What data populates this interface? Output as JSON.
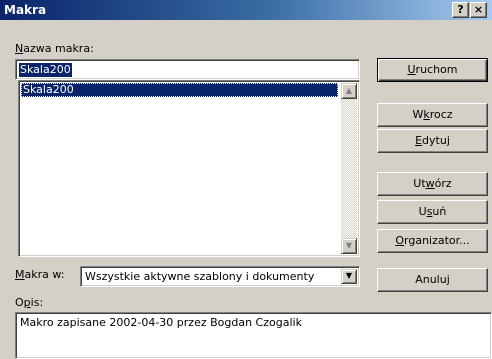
{
  "window": {
    "title": "Makra",
    "help_glyph": "?",
    "close_glyph": "×"
  },
  "name_field": {
    "label_pre": "",
    "label_mn": "N",
    "label_post": "azwa makra:",
    "value": "Skala200"
  },
  "macro_list": {
    "items": [
      "Skala200"
    ],
    "scroll_up_glyph": "▲",
    "scroll_down_glyph": "▼"
  },
  "macros_in": {
    "label_pre": "",
    "label_mn": "M",
    "label_post": "akra w:",
    "value": "Wszystkie aktywne szablony i dokumenty",
    "arrow_glyph": "▼"
  },
  "description": {
    "label_pre": "O",
    "label_mn": "p",
    "label_post": "is:",
    "text": "Makro zapisane 2002-04-30 przez Bogdan Czogalik"
  },
  "buttons": {
    "run": {
      "pre": "",
      "mn": "U",
      "post": "ruchom"
    },
    "step_into": {
      "pre": "W",
      "mn": "k",
      "post": "rocz"
    },
    "edit": {
      "pre": "",
      "mn": "E",
      "post": "dytuj"
    },
    "create": {
      "pre": "Ut",
      "mn": "w",
      "post": "órz"
    },
    "delete": {
      "pre": "U",
      "mn": "s",
      "post": "uń"
    },
    "organizer": {
      "pre": "",
      "mn": "O",
      "post": "rganizator..."
    },
    "cancel": {
      "pre": "",
      "mn": "",
      "post": "Anuluj"
    }
  }
}
